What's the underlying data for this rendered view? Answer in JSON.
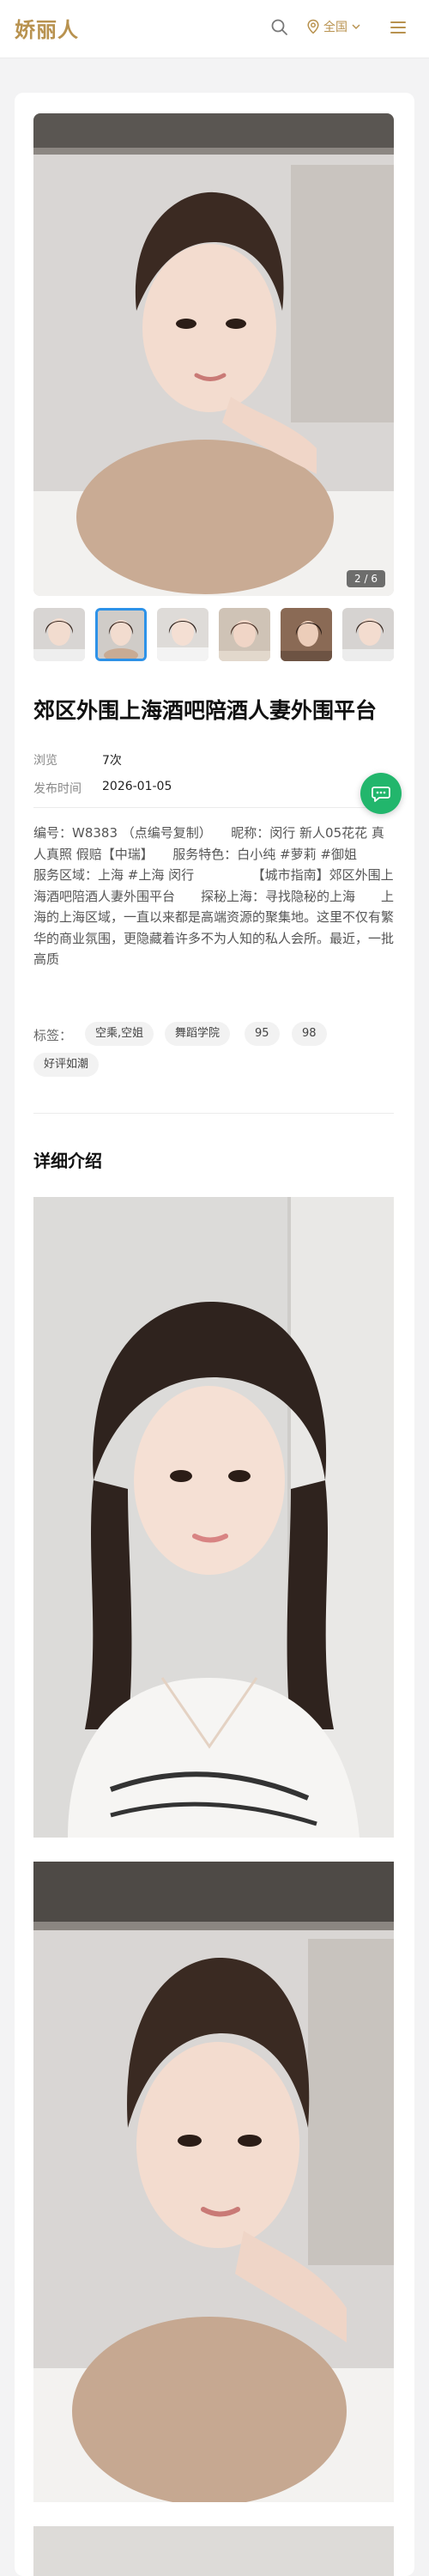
{
  "header": {
    "logo": "娇丽人",
    "location_label": "全国",
    "icons": {
      "search": "search-icon",
      "location": "location-pin-icon",
      "dropdown": "chevron-down-icon",
      "menu": "hamburger-menu-icon"
    },
    "accent_color": "#b8924f"
  },
  "gallery": {
    "counter": "2 / 6",
    "thumbnail_count": 6,
    "active_thumbnail_index": 1
  },
  "post": {
    "title": "郊区外围上海酒吧陪酒人妻外围平台",
    "views_label": "浏览",
    "views_value": "7次",
    "date_label": "发布时间",
    "date_value": "2026-01-05",
    "description": "编号：W8383 （点编号复制）　　昵称：闵行 新人05花花 真人真照 假赔【中瑞】　　服务特色：白小纯 #萝莉 #御姐　　服务区域：上海 #上海 闵行　　　　　【城市指南】郊区外围上海酒吧陪酒人妻外围平台　　探秘上海：寻找隐秘的上海　　上海的上海区域，一直以来都是高端资源的聚集地。这里不仅有繁华的商业氛围，更隐藏着许多不为人知的私人会所。最近，一批高质",
    "tags_label": "标签：",
    "tags": [
      "空乘,空姐",
      "舞蹈学院",
      "95",
      "98",
      "好评如潮"
    ]
  },
  "detail": {
    "section_title": "详细介绍"
  },
  "floating": {
    "chat_icon": "chat-bubble-icon",
    "chat_color": "#22b66c"
  }
}
